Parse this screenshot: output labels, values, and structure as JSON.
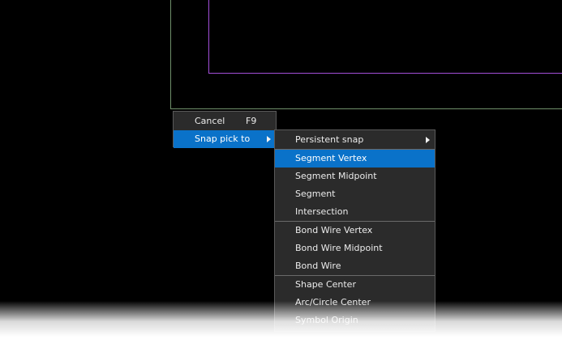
{
  "context_menu": {
    "items": [
      {
        "label": "Cancel",
        "shortcut": "F9"
      },
      {
        "label": "Snap pick to",
        "shortcut": ""
      }
    ]
  },
  "snap_submenu": {
    "groups": [
      [
        "Persistent snap"
      ],
      [
        "Segment Vertex",
        "Segment Midpoint",
        "Segment",
        "Intersection"
      ],
      [
        "Bond Wire Vertex",
        "Bond Wire Midpoint",
        "Bond Wire"
      ],
      [
        "Shape Center",
        "Arc/Circle Center",
        "Symbol Origin"
      ]
    ],
    "highlighted": "Segment Vertex"
  },
  "colors": {
    "canvas_bg": "#000000",
    "board_outline": "#6f8f6a",
    "shape_outline": "#a24fd8",
    "menu_bg": "#2b2b2b",
    "highlight": "#0a72c9"
  }
}
